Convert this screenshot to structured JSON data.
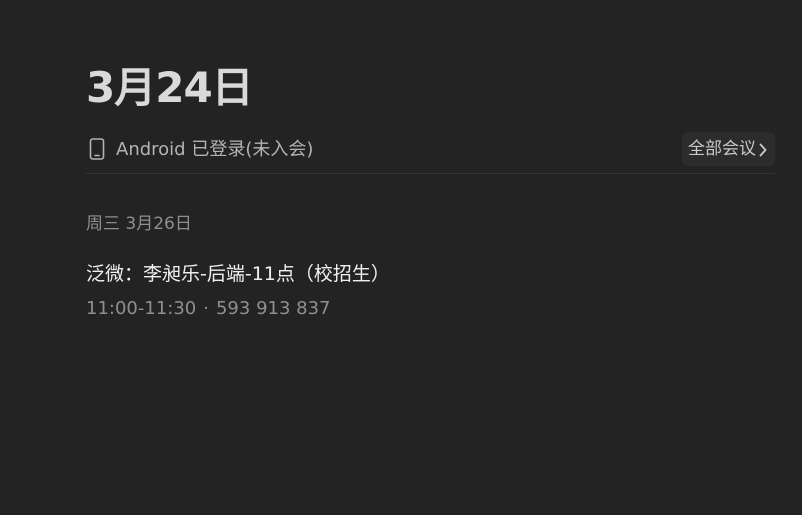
{
  "header": {
    "date_title": "3月24日"
  },
  "device_status": {
    "icon": "mobile-phone-icon",
    "text": "Android 已登录(未入会)"
  },
  "actions": {
    "all_meetings_label": "全部会议",
    "all_meetings_icon": "chevron-right-icon"
  },
  "schedule": {
    "day_label": "周三 3月26日",
    "meetings": [
      {
        "title": "泛微：李昶乐-后端-11点（校招生）",
        "time": "11:00-11:30",
        "separator": "·",
        "meeting_id": "593 913 837"
      }
    ]
  },
  "colors": {
    "background": "#232323",
    "title_text": "#d9d9d9",
    "primary_text": "#f0f0f0",
    "secondary_text": "#8f8f8f",
    "button_background": "#2c2c2c"
  }
}
